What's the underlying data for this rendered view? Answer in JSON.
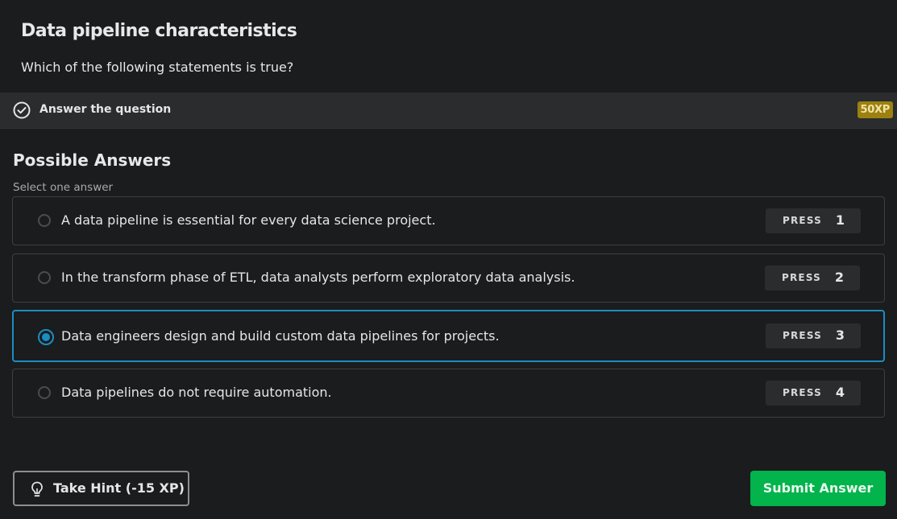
{
  "exercise": {
    "title": "Data pipeline characteristics",
    "question": "Which of the following statements is true?"
  },
  "task": {
    "label": "Answer the question",
    "xp": "50XP",
    "xp_color": "#9c8010",
    "icon": "check-circle-icon"
  },
  "answers_section": {
    "heading": "Possible Answers",
    "subheading": "Select one answer",
    "selected_index": 2,
    "accent_color": "#1a8ec2",
    "options": [
      {
        "text": "A data pipeline is essential for every data science project.",
        "press_label": "PRESS",
        "key": "1"
      },
      {
        "text": "In the transform phase of ETL, data analysts perform exploratory data analysis.",
        "press_label": "PRESS",
        "key": "2"
      },
      {
        "text": "Data engineers design and build custom data pipelines for projects.",
        "press_label": "PRESS",
        "key": "3"
      },
      {
        "text": "Data pipelines do not require automation.",
        "press_label": "PRESS",
        "key": "4"
      }
    ]
  },
  "actions": {
    "hint_label": "Take Hint (-15 XP)",
    "hint_icon": "lightbulb-icon",
    "submit_label": "Submit Answer",
    "submit_color": "#03b34c"
  }
}
